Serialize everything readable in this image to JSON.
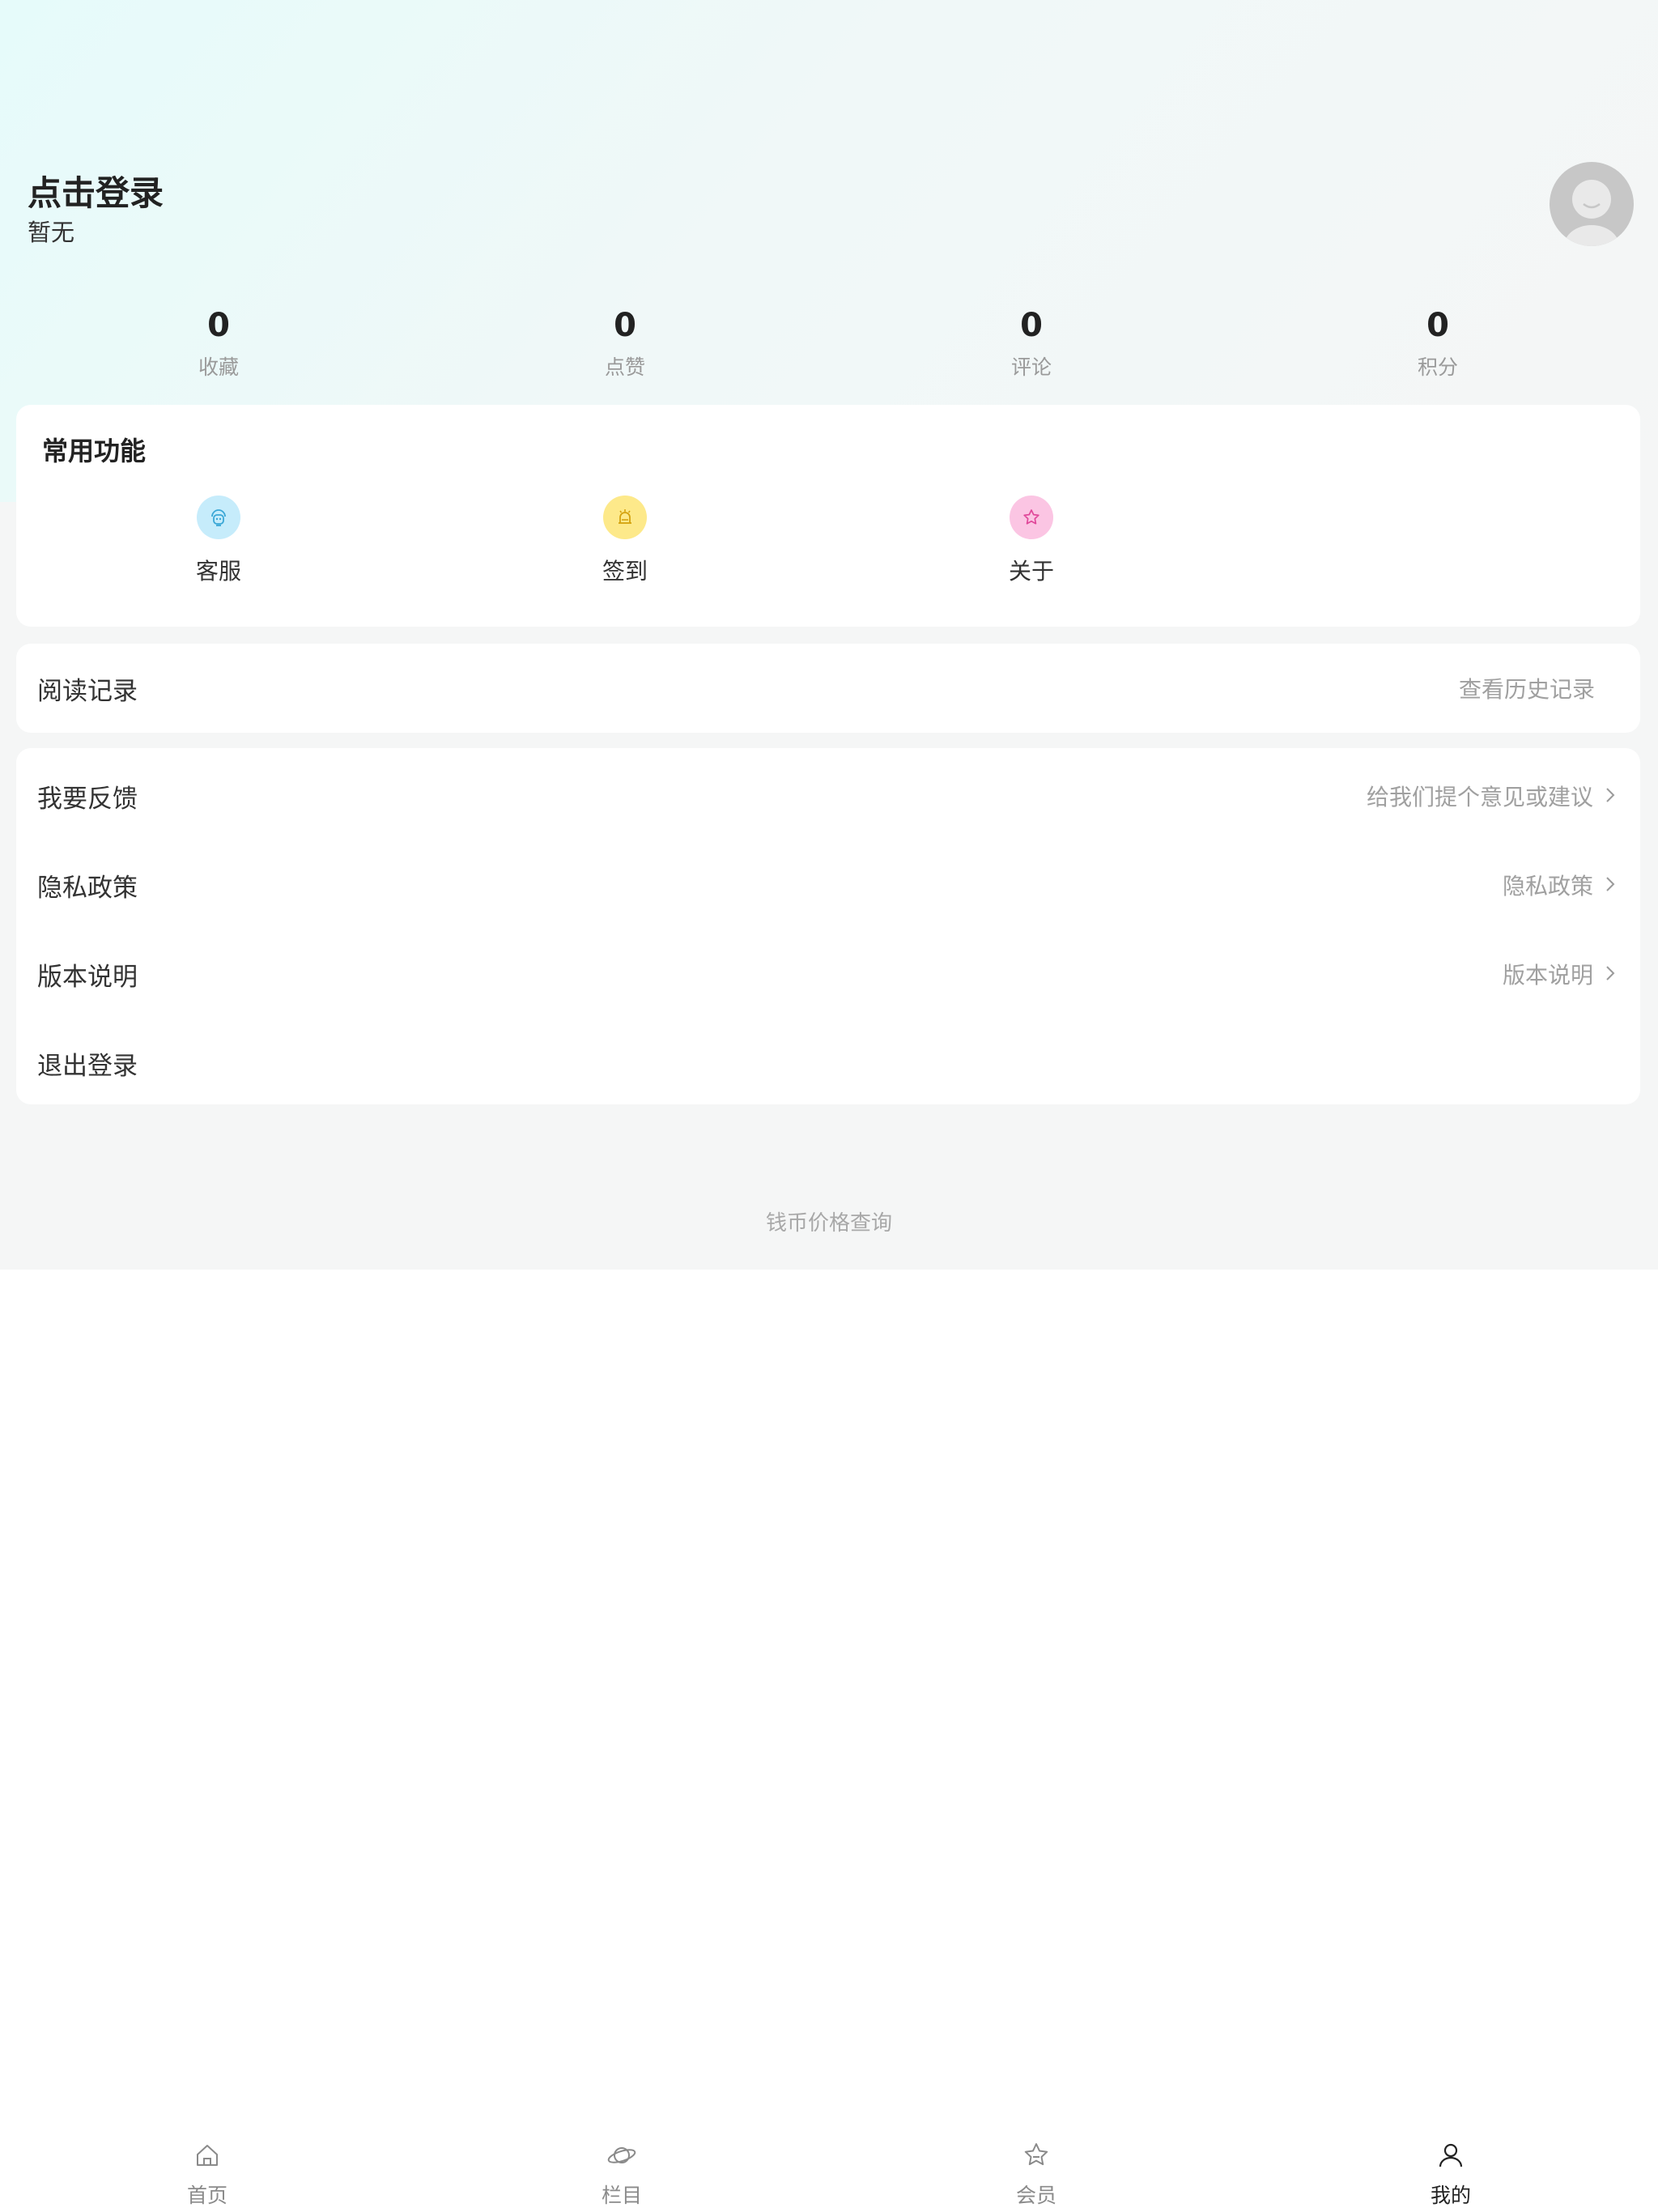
{
  "profile": {
    "title": "点击登录",
    "subtitle": "暂无"
  },
  "stats": [
    {
      "value": "0",
      "label": "收藏"
    },
    {
      "value": "0",
      "label": "点赞"
    },
    {
      "value": "0",
      "label": "评论"
    },
    {
      "value": "0",
      "label": "积分"
    }
  ],
  "common": {
    "title": "常用功能",
    "items": [
      {
        "label": "客服",
        "icon": "customer-service-icon",
        "color": "#c6ecfb",
        "stroke": "#3aa7d6"
      },
      {
        "label": "签到",
        "icon": "sign-in-icon",
        "color": "#fde98a",
        "stroke": "#d4a20f"
      },
      {
        "label": "关于",
        "icon": "star-icon",
        "color": "#fbc5e3",
        "stroke": "#e0489a"
      }
    ]
  },
  "reading": {
    "label": "阅读记录",
    "action": "查看历史记录"
  },
  "menu": [
    {
      "label": "我要反馈",
      "hint": "给我们提个意见或建议"
    },
    {
      "label": "隐私政策",
      "hint": "隐私政策"
    },
    {
      "label": "版本说明",
      "hint": "版本说明"
    },
    {
      "label": "退出登录",
      "hint": ""
    }
  ],
  "footer": {
    "link": "钱币价格查询"
  },
  "tabbar": [
    {
      "label": "首页",
      "icon": "home-icon"
    },
    {
      "label": "栏目",
      "icon": "planet-icon"
    },
    {
      "label": "会员",
      "icon": "star-outline-icon"
    },
    {
      "label": "我的",
      "icon": "user-icon",
      "active": true
    }
  ]
}
